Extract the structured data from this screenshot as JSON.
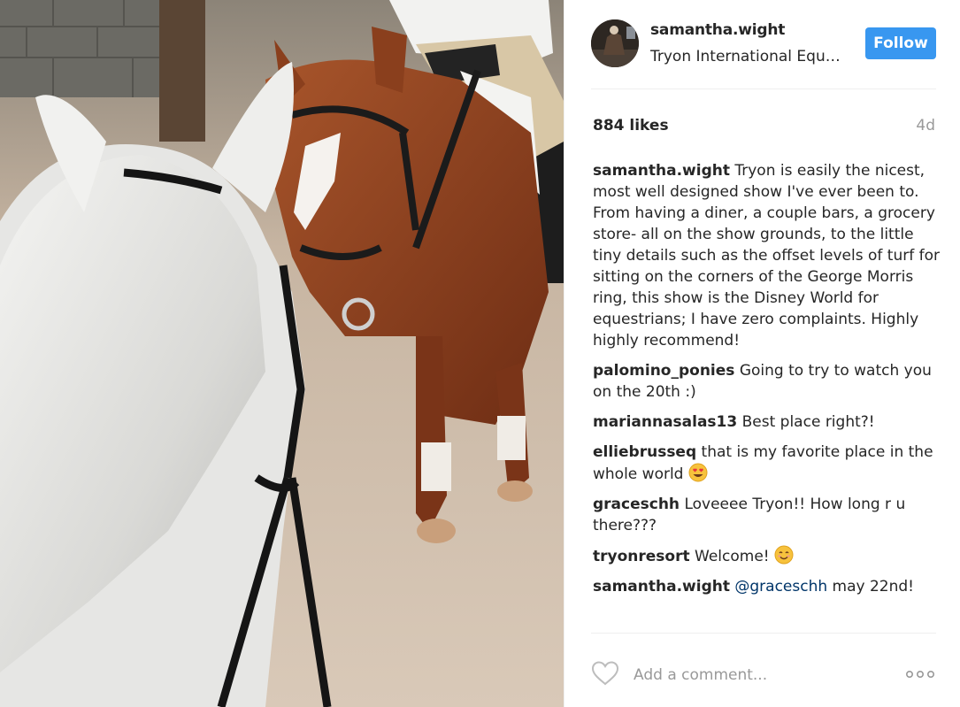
{
  "post": {
    "username": "samantha.wight",
    "location": "Tryon International Equestrian Center",
    "follow_label": "Follow",
    "likes": "884 likes",
    "time": "4d",
    "comments": [
      {
        "author": "samantha.wight",
        "text": "Tryon is easily the nicest, most well designed show I've ever been to. From having a diner, a couple bars, a grocery store- all on the show grounds, to the little tiny details such as the offset levels of turf for sitting on the corners of the George Morris ring, this show is the Disney World for equestrians; I have zero complaints. Highly highly recommend!"
      },
      {
        "author": "palomino_ponies",
        "text": "Going to try to watch you on the 20th :)"
      },
      {
        "author": "mariannasalas13",
        "text": "Best place right?!"
      },
      {
        "author": "elliebrusseq",
        "text": "that is my favorite place in the whole world",
        "emoji": "heart-eyes-emoji"
      },
      {
        "author": "graceschh",
        "text": "Loveeee Tryon!! How long r u there???"
      },
      {
        "author": "tryonresort",
        "text": "Welcome!",
        "emoji": "smiling-face-emoji"
      },
      {
        "author": "samantha.wight",
        "mention": "@graceschh",
        "text": "may 22nd!"
      }
    ],
    "comment_placeholder": "Add a comment...",
    "icons": {
      "like": "heart-icon",
      "more": "more-options-icon"
    },
    "colors": {
      "accent": "#3897f0",
      "mention": "#003569",
      "muted": "#999999"
    }
  }
}
